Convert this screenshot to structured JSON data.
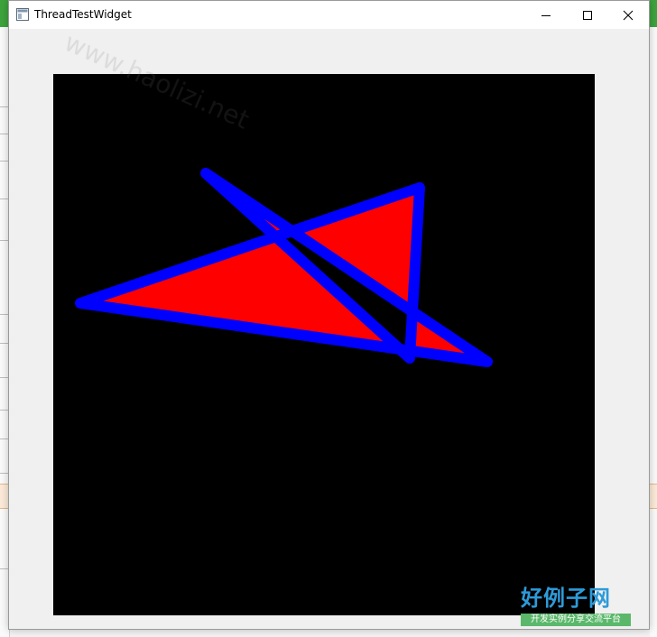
{
  "window": {
    "title": "ThreadTestWidget"
  },
  "icons": {
    "app": "window-app-icon",
    "minimize": "minimize-icon",
    "maximize": "maximize-icon",
    "close": "close-icon"
  },
  "colors": {
    "canvas_background": "#000000",
    "star_fill": "#ff0000",
    "star_stroke": "#0000ff",
    "window_background": "#f0f0f0",
    "logo_text": "#2e9ad8",
    "logo_banner": "#5bb86b"
  },
  "watermark": {
    "text": "www.haolizi.net"
  },
  "logo": {
    "main": "好例子网",
    "sub": "开发实例分享交流平台"
  }
}
